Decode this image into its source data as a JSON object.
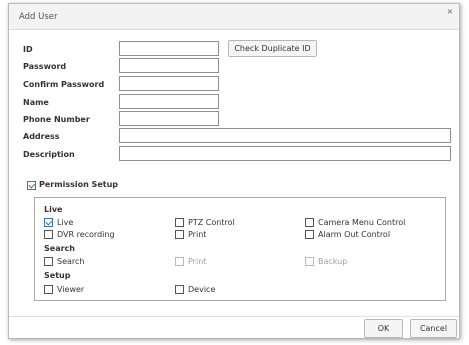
{
  "dialog": {
    "title": "Add User",
    "close_glyph": "×"
  },
  "form": {
    "id_label": "ID",
    "password_label": "Password",
    "confirm_password_label": "Confirm Password",
    "name_label": "Name",
    "phone_label": "Phone Number",
    "address_label": "Address",
    "description_label": "Description",
    "check_duplicate_label": "Check Duplicate ID",
    "id_value": "",
    "password_value": "",
    "confirm_password_value": "",
    "name_value": "",
    "phone_value": "",
    "address_value": "",
    "description_value": ""
  },
  "permission": {
    "setup_label": "Permission Setup",
    "setup_checked": true,
    "sections": {
      "live": {
        "title": "Live",
        "items": [
          {
            "label": "Live",
            "checked": true,
            "disabled": false
          },
          {
            "label": "PTZ Control",
            "checked": false,
            "disabled": false
          },
          {
            "label": "Camera Menu Control",
            "checked": false,
            "disabled": false
          },
          {
            "label": "DVR recording",
            "checked": false,
            "disabled": false
          },
          {
            "label": "Print",
            "checked": false,
            "disabled": false
          },
          {
            "label": "Alarm Out Control",
            "checked": false,
            "disabled": false
          }
        ]
      },
      "search": {
        "title": "Search",
        "items": [
          {
            "label": "Search",
            "checked": false,
            "disabled": false
          },
          {
            "label": "Print",
            "checked": false,
            "disabled": true
          },
          {
            "label": "Backup",
            "checked": false,
            "disabled": true
          }
        ]
      },
      "setup": {
        "title": "Setup",
        "items": [
          {
            "label": "Viewer",
            "checked": false,
            "disabled": false
          },
          {
            "label": "Device",
            "checked": false,
            "disabled": false
          }
        ]
      }
    }
  },
  "footer": {
    "ok_label": "OK",
    "cancel_label": "Cancel"
  }
}
